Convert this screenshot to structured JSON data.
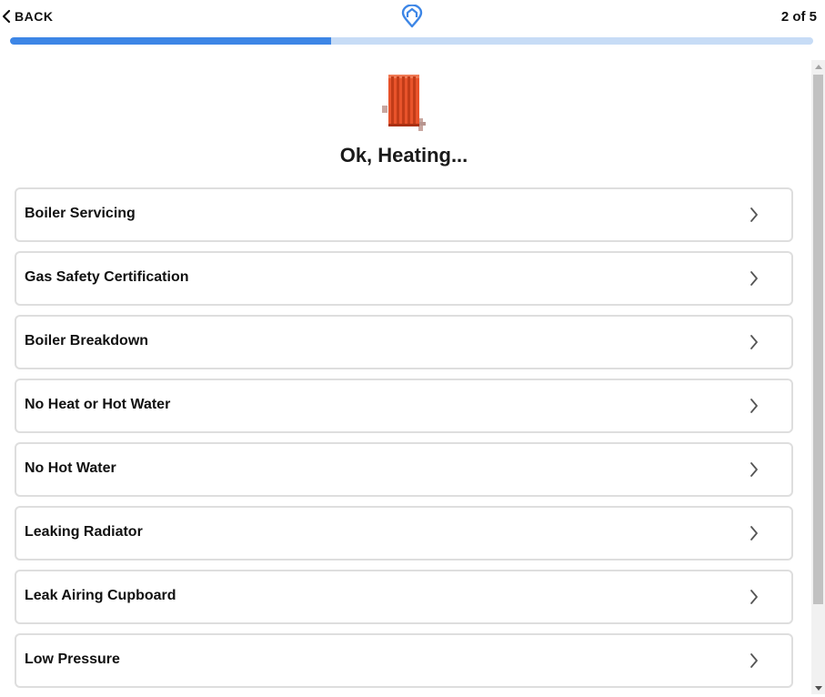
{
  "header": {
    "back_label": "BACK",
    "step_text": "2 of 5",
    "progress_fraction": 0.4,
    "logo_icon": "map-pin-home-icon"
  },
  "main": {
    "hero_icon": "radiator-icon",
    "title": "Ok, Heating...",
    "options": [
      {
        "label": "Boiler Servicing"
      },
      {
        "label": "Gas Safety Certification"
      },
      {
        "label": "Boiler Breakdown"
      },
      {
        "label": "No Heat or Hot Water"
      },
      {
        "label": "No Hot Water"
      },
      {
        "label": "Leaking Radiator"
      },
      {
        "label": "Leak Airing Cupboard"
      },
      {
        "label": "Low Pressure"
      }
    ]
  },
  "colors": {
    "accent": "#3d86e6",
    "progress_track": "#c7dcf6",
    "radiator": "#e8532b",
    "card_border": "#dedede"
  }
}
